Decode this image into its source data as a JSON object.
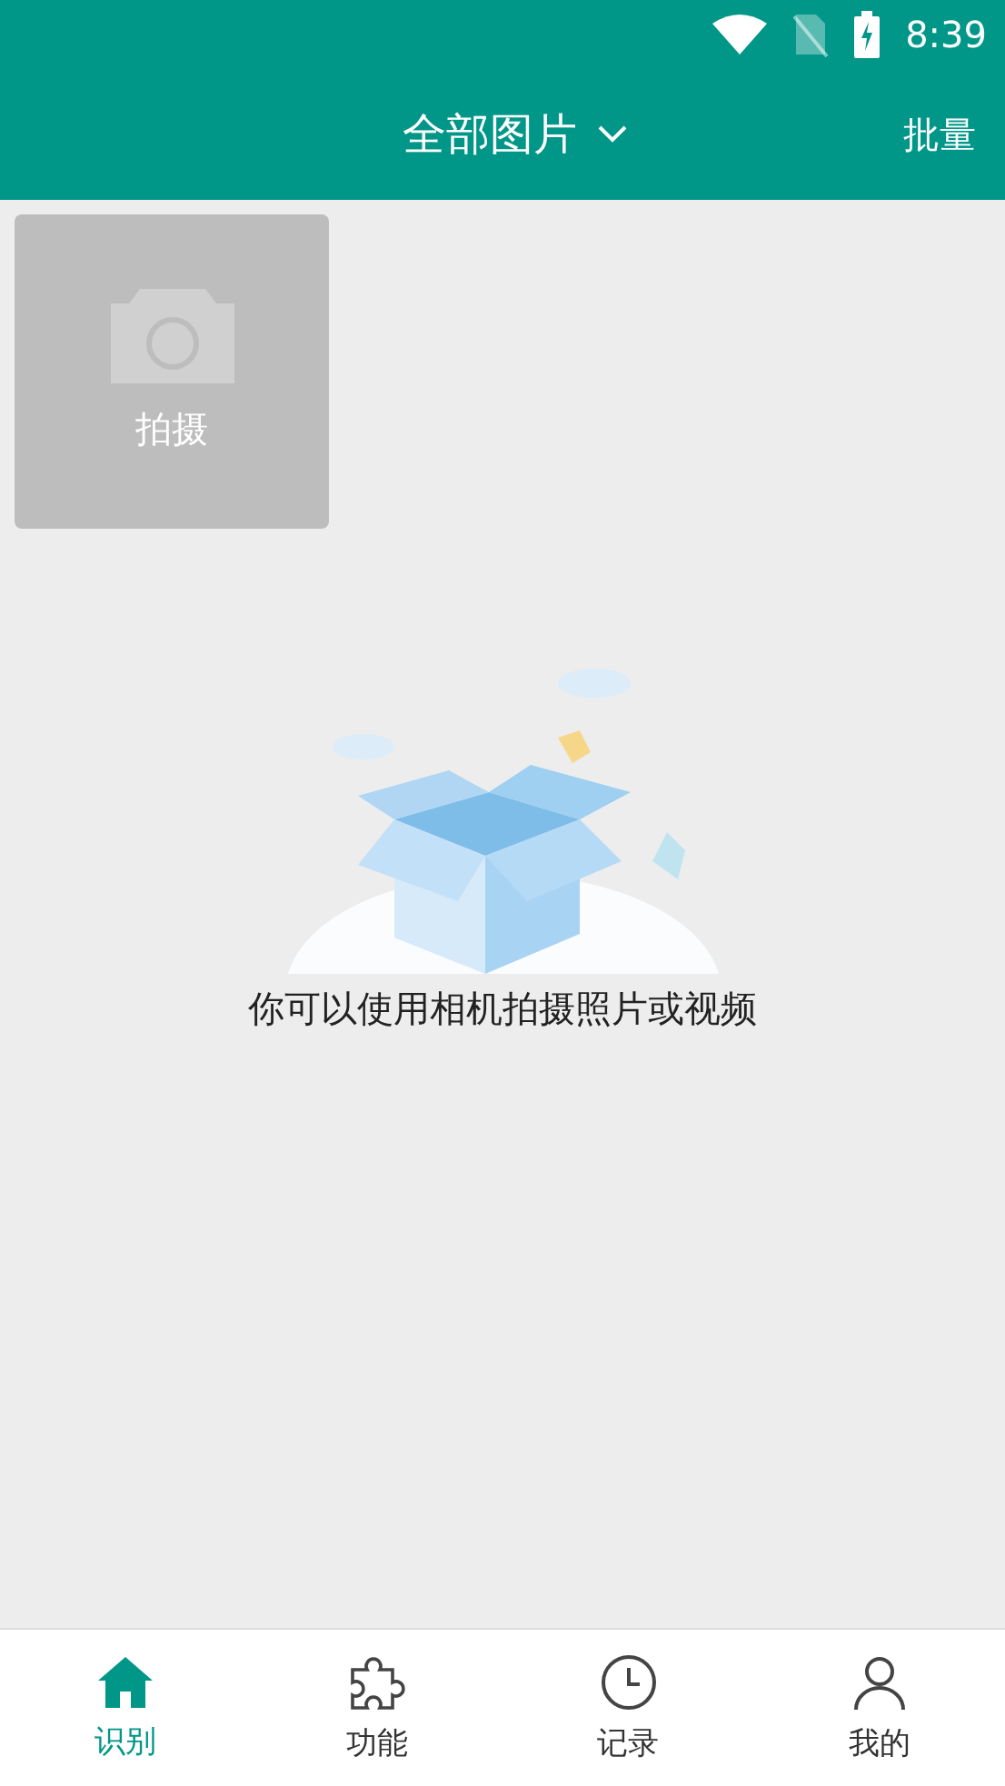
{
  "status_bar": {
    "time": "8:39"
  },
  "header": {
    "title": "全部图片",
    "action": "批量"
  },
  "capture_tile": {
    "label": "拍摄"
  },
  "empty_state": {
    "message": "你可以使用相机拍摄照片或视频"
  },
  "tabs": [
    {
      "label": "识别",
      "kind": "home",
      "selected": true
    },
    {
      "label": "功能",
      "kind": "puzzle",
      "selected": false
    },
    {
      "label": "记录",
      "kind": "clock",
      "selected": false
    },
    {
      "label": "我的",
      "kind": "person",
      "selected": false
    }
  ]
}
